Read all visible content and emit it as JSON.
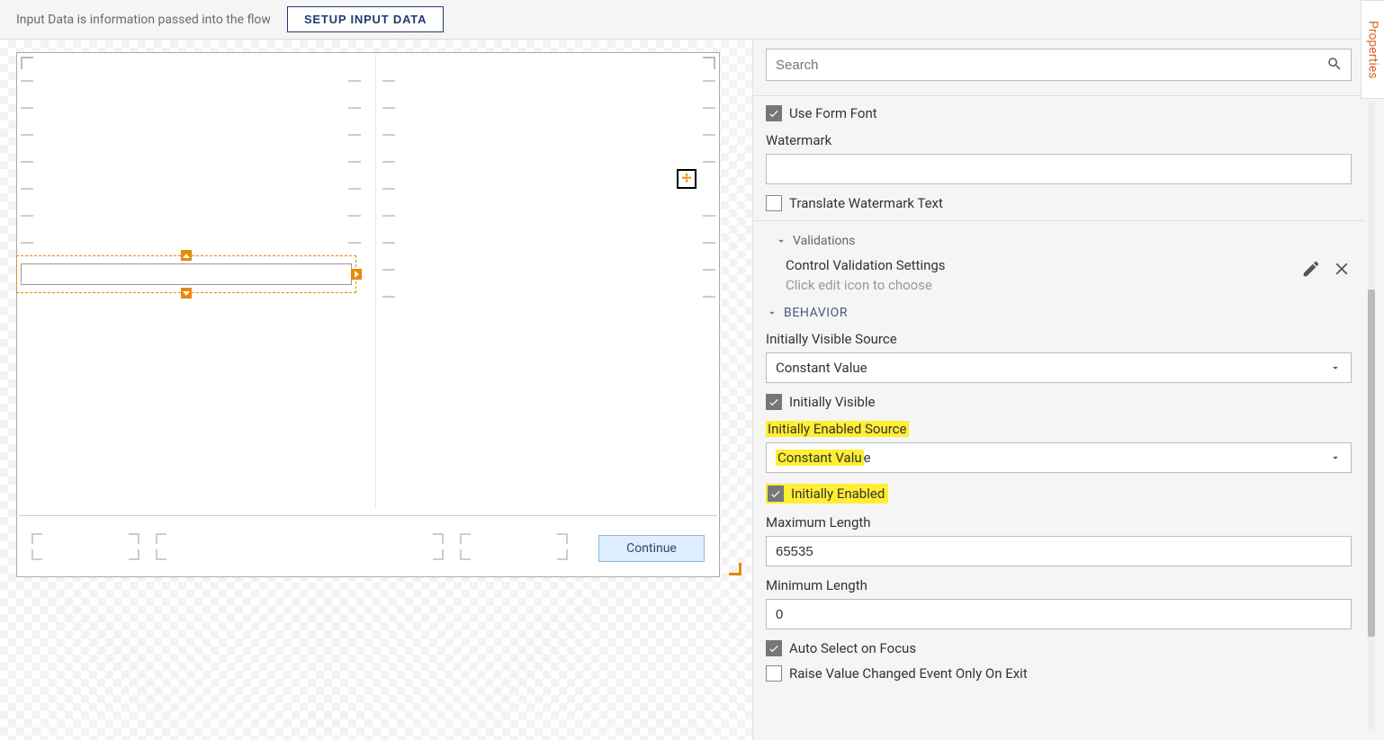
{
  "header": {
    "description": "Input Data is information passed into the flow",
    "setup_button": "SETUP INPUT DATA"
  },
  "canvas": {
    "continue_button": "Continue"
  },
  "search": {
    "placeholder": "Search"
  },
  "panel_tab": "Properties",
  "props": {
    "use_form_font": {
      "label": "Use Form Font",
      "checked": true
    },
    "watermark_label": "Watermark",
    "watermark_value": "",
    "translate_wm": {
      "label": "Translate Watermark Text",
      "checked": false
    },
    "validations_header": "Validations",
    "validation_settings": "Control Validation Settings",
    "validation_hint": "Click edit icon to choose",
    "behavior_header": "BEHAVIOR",
    "init_visible_source_label": "Initially Visible Source",
    "init_visible_source_value": "Constant Value",
    "init_visible": {
      "label": "Initially Visible",
      "checked": true
    },
    "init_enabled_source_label": "Initially Enabled Source",
    "init_enabled_source_value_hi": "Constant Valu",
    "init_enabled_source_value_rest": "e",
    "init_enabled": {
      "label": "Initially Enabled",
      "checked": true
    },
    "max_len_label": "Maximum Length",
    "max_len_value": "65535",
    "min_len_label": "Minimum Length",
    "min_len_value": "0",
    "auto_select": {
      "label": "Auto Select on Focus",
      "checked": true
    },
    "raise_event": {
      "label": "Raise Value Changed Event Only On Exit",
      "checked": false
    }
  }
}
